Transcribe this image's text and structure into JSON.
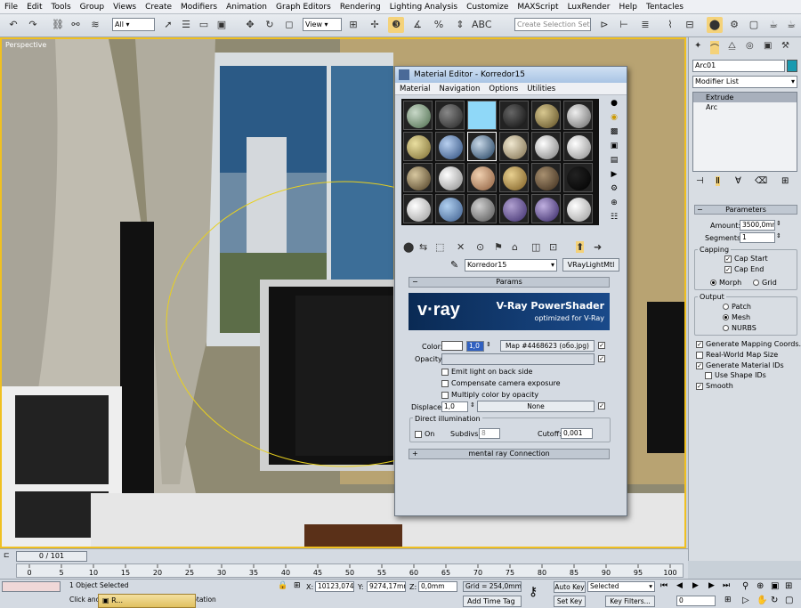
{
  "menubar": [
    "File",
    "Edit",
    "Tools",
    "Group",
    "Views",
    "Create",
    "Modifiers",
    "Animation",
    "Graph Editors",
    "Rendering",
    "Lighting Analysis",
    "Customize",
    "MAXScript",
    "LuxRender",
    "Help",
    "Tentacles"
  ],
  "toolbar": {
    "filter_select": "All",
    "coord_select": "View",
    "selection_set_placeholder": "Create Selection Set"
  },
  "viewport": {
    "label": "Perspective"
  },
  "command_panel": {
    "object_name": "Arc01",
    "modifier_list": "Modifier List",
    "stack": [
      "Extrude",
      "Arc"
    ],
    "parameters_title": "Parameters",
    "amount_label": "Amount:",
    "amount_value": "3500,0mm",
    "segments_label": "Segments:",
    "segments_value": "1",
    "capping_label": "Capping",
    "cap_start": "Cap Start",
    "cap_end": "Cap End",
    "morph": "Morph",
    "grid": "Grid",
    "output_label": "Output",
    "patch": "Patch",
    "mesh": "Mesh",
    "nurbs": "NURBS",
    "gen_mapping": "Generate Mapping Coords.",
    "real_world": "Real-World Map Size",
    "gen_matids": "Generate Material IDs",
    "use_shape_ids": "Use Shape IDs",
    "smooth": "Smooth"
  },
  "material_editor": {
    "title": "Material Editor - Korredor15",
    "menu": [
      "Material",
      "Navigation",
      "Options",
      "Utilities"
    ],
    "material_name": "Korredor15",
    "material_type": "VRayLightMtl",
    "params_title": "Params",
    "banner_brand": "v·ray",
    "banner_title": "V-Ray PowerShader",
    "banner_sub": "optimized for V-Ray",
    "color_label": "Color:",
    "color_value": "1,0",
    "color_map": "Map #4468623 (обо.jpg)",
    "opacity_label": "Opacity:",
    "emit_back": "Emit light on back side",
    "compensate": "Compensate camera exposure",
    "multiply": "Multiply color by opacity",
    "displace_label": "Displace:",
    "displace_value": "1,0",
    "displace_map": "None",
    "direct_label": "Direct illumination",
    "on_label": "On",
    "subdivs_label": "Subdivs:",
    "subdivs_value": "8",
    "cutoff_label": "Cutoff:",
    "cutoff_value": "0,001",
    "mental_ray": "mental ray Connection"
  },
  "timeline": {
    "frame": "0 / 101",
    "ticks": [
      "0",
      "5",
      "10",
      "15",
      "20",
      "25",
      "30",
      "35",
      "40",
      "45",
      "50",
      "55",
      "60",
      "65",
      "70",
      "75",
      "80",
      "85",
      "90",
      "95",
      "100"
    ]
  },
  "statusbar": {
    "selection": "1 Object Selected",
    "prompt": "Click and ... the tabs constrains the rotation",
    "x_label": "X:",
    "x_value": "10123,074",
    "y_label": "Y:",
    "y_value": "9274,17mm",
    "z_label": "Z:",
    "z_value": "0,0mm",
    "grid": "Grid = 254,0mm",
    "add_time_tag": "Add Time Tag",
    "auto_key": "Auto Key",
    "selected": "Selected",
    "set_key": "Set Key",
    "key_filters": "Key Filters...",
    "frame_value": "0",
    "taskbar_item": "R..."
  },
  "colors": {
    "accent_arrow": "#22e07a",
    "vp_border": "#f0c020"
  }
}
